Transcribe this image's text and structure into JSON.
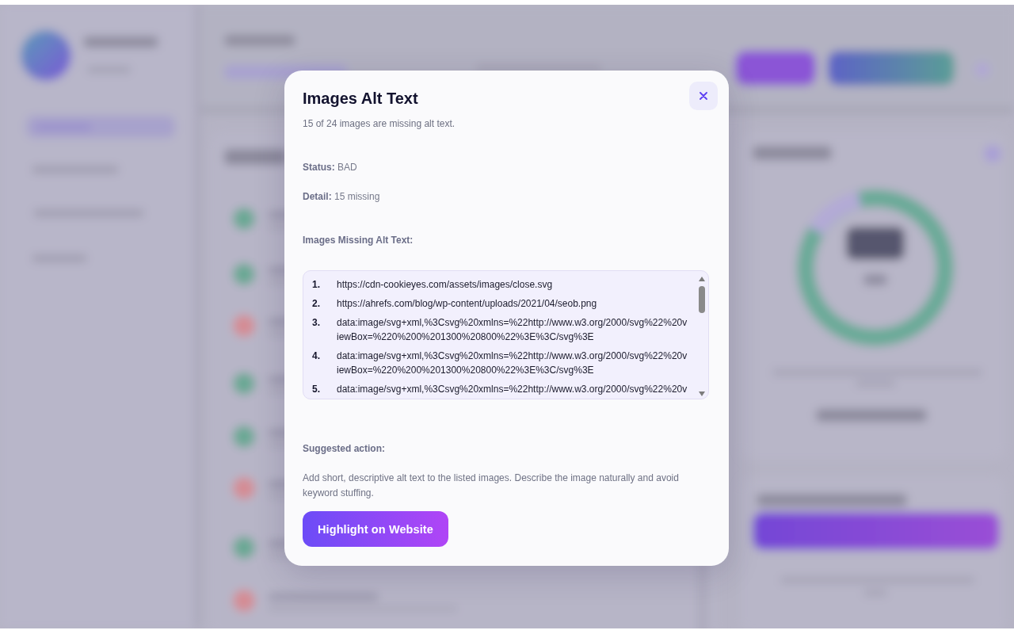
{
  "dialog": {
    "title": "Images Alt Text",
    "summary": "15 of 24 images are missing alt text.",
    "details": [
      "**Status:** BAD",
      "**Detail:** 15 missing"
    ],
    "list_heading": "Images Missing Alt Text:",
    "images": [
      {
        "number": "1.",
        "url": "https://cdn-cookieyes.com/assets/images/close.svg"
      },
      {
        "number": "2.",
        "url": "https://ahrefs.com/blog/wp-content/uploads/2021/04/seob.png"
      },
      {
        "number": "3.",
        "url": "data:image/svg+xml,%3Csvg%20xmlns=%22http://www.w3.org/2000/svg%22%20viewBox=%220%200%201300%20800%22%3E%3C/svg%3E"
      },
      {
        "number": "4.",
        "url": "data:image/svg+xml,%3Csvg%20xmlns=%22http://www.w3.org/2000/svg%22%20viewBox=%220%200%201300%20800%22%3E%3C/svg%3E"
      },
      {
        "number": "5.",
        "url": "data:image/svg+xml,%3Csvg%20xmlns=%22http://www.w3.org/2000/svg%22%20v"
      }
    ],
    "suggested_action_heading": "Suggested action:",
    "suggested_action": "Add short, descriptive alt text to the listed images. Describe the image naturally and avoid keyword stuffing.",
    "button": "Highlight on Website"
  }
}
